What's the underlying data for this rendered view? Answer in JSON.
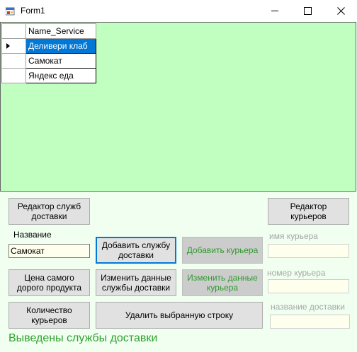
{
  "window": {
    "title": "Form1"
  },
  "grid": {
    "column_header": "Name_Service",
    "rows": [
      "Деливери клаб",
      "Самокат",
      "Яндекс еда"
    ],
    "selected_index": 0
  },
  "buttons": {
    "edit_services": "Редактор служб доставки",
    "edit_couriers": "Редактор курьеров",
    "add_service": "Добавить службу доставки",
    "add_courier": "Добавить курьера",
    "price_expensive": "Цена самого дорого продукта",
    "change_service": "Изменить данные службы доставки",
    "change_courier": "Изменить данные курьера",
    "couriers_count": "Количество курьеров",
    "delete_row": "Удалить выбранную строку"
  },
  "labels": {
    "name": "Название",
    "courier_name": "имя курьера",
    "courier_number": "номер курьера",
    "delivery_name": "название доставки"
  },
  "inputs": {
    "name_value": "Самокат",
    "courier_name_value": "",
    "courier_number_value": "",
    "delivery_name_value": ""
  },
  "status": "Выведены службы доставки",
  "colors": {
    "form_bg": "#f0fff0",
    "grid_bg": "#c0ffc0",
    "selection": "#0078d7",
    "status_text": "#2ea02e"
  }
}
